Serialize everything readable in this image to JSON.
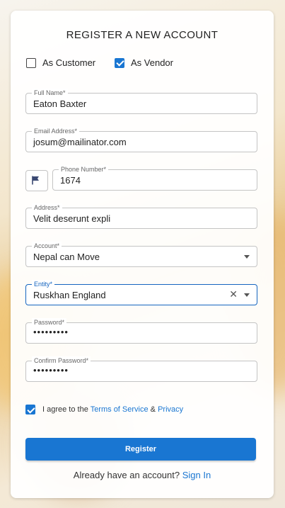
{
  "title": "REGISTER A NEW ACCOUNT",
  "roles": [
    {
      "label": "As Customer",
      "checked": false
    },
    {
      "label": "As Vendor",
      "checked": true
    }
  ],
  "fields": {
    "full_name": {
      "label": "Full Name*",
      "value": "Eaton Baxter"
    },
    "email": {
      "label": "Email Address*",
      "value": "josum@mailinator.com"
    },
    "phone": {
      "label": "Phone Number*",
      "value": "1674",
      "country_icon": "flag-icon"
    },
    "address": {
      "label": "Address*",
      "value": "Velit deserunt expli"
    },
    "account": {
      "label": "Account*",
      "value": "Nepal can Move"
    },
    "entity": {
      "label": "Entity*",
      "value": "Ruskhan England"
    },
    "password": {
      "label": "Password*",
      "value": "•••••••••"
    },
    "confirm_password": {
      "label": "Confirm Password*",
      "value": "•••••••••"
    }
  },
  "agree": {
    "checked": true,
    "prefix": "I agree to the",
    "terms": "Terms of Service",
    "amp": "&",
    "privacy": "Privacy"
  },
  "register_button": "Register",
  "signin": {
    "text": "Already have an account?",
    "link": "Sign In"
  },
  "colors": {
    "primary": "#1976d2",
    "focus": "#1565c0"
  }
}
